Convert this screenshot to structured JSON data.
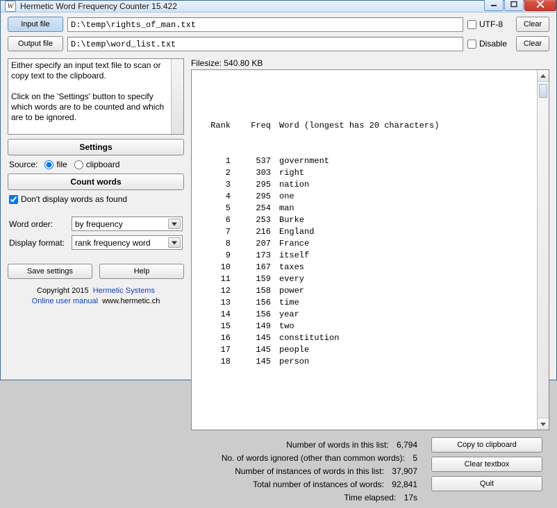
{
  "window": {
    "title": "Hermetic Word Frequency Counter 15.422"
  },
  "file_rows": {
    "input_button": "Input file",
    "input_path": "D:\\temp\\rights_of_man.txt",
    "utf8_label": "UTF-8",
    "utf8_checked": false,
    "clear1": "Clear",
    "output_button": "Output file",
    "output_path": "D:\\temp\\word_list.txt",
    "disable_label": "Disable",
    "disable_checked": false,
    "clear2": "Clear"
  },
  "instructions": "Either specify an input text file to scan or copy text to the clipboard.\n\nClick on the 'Settings' button to specify which words are to be counted and which are to be ignored.",
  "left": {
    "settings": "Settings",
    "source_label": "Source:",
    "radio_file": "file",
    "radio_clipboard": "clipboard",
    "source_selected": "file",
    "count_words": "Count words",
    "dont_display_label": "Don't display words as found",
    "dont_display_checked": true,
    "word_order_label": "Word order:",
    "word_order_value": "by frequency",
    "display_format_label": "Display format:",
    "display_format_value": "rank frequency word",
    "save_settings": "Save settings",
    "help": "Help",
    "copyright": "Copyright 2015",
    "company_link": "Hermetic Systems",
    "manual_link": "Online user manual",
    "site": "www.hermetic.ch"
  },
  "right": {
    "filesize_label": "Filesize:",
    "filesize_value": "540.80 KB",
    "table_header_rank": "Rank",
    "table_header_freq": "Freq",
    "table_header_word": "Word (longest has 20 characters)",
    "rows": [
      {
        "rank": "1",
        "freq": "537",
        "word": "government"
      },
      {
        "rank": "2",
        "freq": "303",
        "word": "right"
      },
      {
        "rank": "3",
        "freq": "295",
        "word": "nation"
      },
      {
        "rank": "4",
        "freq": "295",
        "word": "one"
      },
      {
        "rank": "5",
        "freq": "254",
        "word": "man"
      },
      {
        "rank": "6",
        "freq": "253",
        "word": "Burke"
      },
      {
        "rank": "7",
        "freq": "216",
        "word": "England"
      },
      {
        "rank": "8",
        "freq": "207",
        "word": "France"
      },
      {
        "rank": "9",
        "freq": "173",
        "word": "itself"
      },
      {
        "rank": "10",
        "freq": "167",
        "word": "taxes"
      },
      {
        "rank": "11",
        "freq": "159",
        "word": "every"
      },
      {
        "rank": "12",
        "freq": "158",
        "word": "power"
      },
      {
        "rank": "13",
        "freq": "156",
        "word": "time"
      },
      {
        "rank": "14",
        "freq": "156",
        "word": "year"
      },
      {
        "rank": "15",
        "freq": "149",
        "word": "two"
      },
      {
        "rank": "16",
        "freq": "145",
        "word": "constitution"
      },
      {
        "rank": "17",
        "freq": "145",
        "word": "people"
      },
      {
        "rank": "18",
        "freq": "145",
        "word": "person"
      }
    ]
  },
  "stats": {
    "s1_label": "Number of words in this list:",
    "s1_value": "6,794",
    "s2_label": "No. of words ignored (other than common words):",
    "s2_value": "5",
    "s3_label": "Number of instances of words in this list:",
    "s3_value": "37,907",
    "s4_label": "Total number of instances of words:",
    "s4_value": "92,841",
    "s5_label": "Time elapsed:",
    "s5_value": "17s"
  },
  "actions": {
    "copy": "Copy to clipboard",
    "clear_textbox": "Clear textbox",
    "quit": "Quit"
  }
}
